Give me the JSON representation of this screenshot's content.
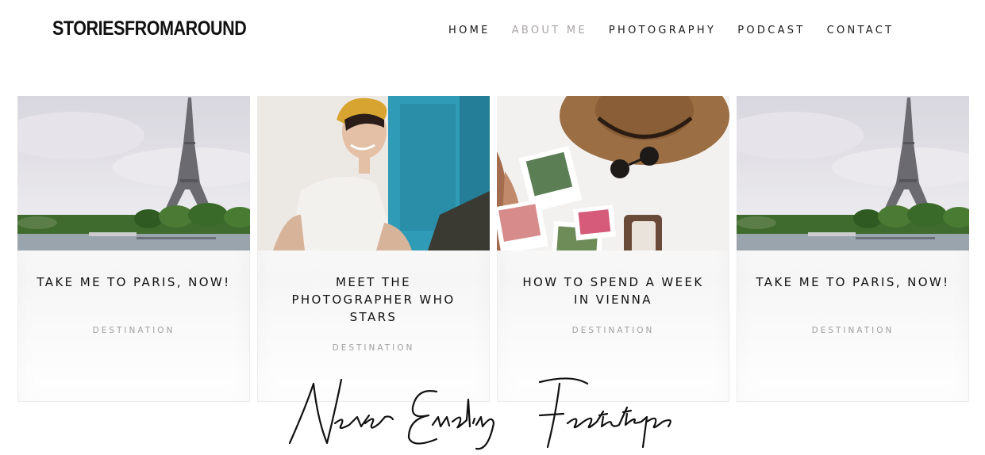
{
  "header": {
    "logo": "STORIESFROMAROUND",
    "nav": [
      {
        "label": "HOME",
        "active": false
      },
      {
        "label": "ABOUT ME",
        "active": true
      },
      {
        "label": "PHOTOGRAPHY",
        "active": false
      },
      {
        "label": "PODCAST",
        "active": false
      },
      {
        "label": "CONTACT",
        "active": false
      }
    ]
  },
  "cards": [
    {
      "title": "TAKE ME TO PARIS, NOW!",
      "category": "DESTINATION",
      "image": "eiffel-tower-photo"
    },
    {
      "title": "MEET THE PHOTOGRAPHER WHO STARS",
      "category": "DESTINATION",
      "image": "smiling-woman-photo"
    },
    {
      "title": "HOW TO SPEND A WEEK IN VIENNA",
      "category": "DESTINATION",
      "image": "hat-and-polaroids-photo"
    },
    {
      "title": "TAKE ME TO PARIS, NOW!",
      "category": "DESTINATION",
      "image": "eiffel-tower-photo"
    }
  ],
  "footer": {
    "script_title": "Never Ending Footsteps"
  },
  "colors": {
    "text": "#111111",
    "nav_active": "#a9a4a4",
    "category": "#a0a0a0"
  }
}
